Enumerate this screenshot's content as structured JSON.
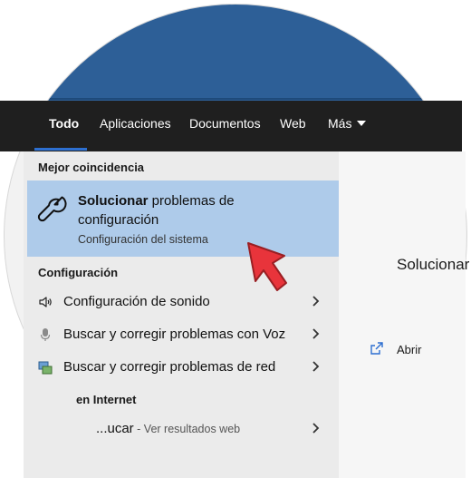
{
  "tabs": [
    {
      "label": "Todo",
      "active": true
    },
    {
      "label": "Aplicaciones"
    },
    {
      "label": "Documentos"
    },
    {
      "label": "Web"
    },
    {
      "label": "Más"
    }
  ],
  "best_match": {
    "section_title": "Mejor coincidencia",
    "title_bold": "Solucionar",
    "title_rest": " problemas de configuración",
    "subtitle": "Configuración del sistema",
    "icon": "wrench-icon"
  },
  "settings_section": {
    "title": "Configuración",
    "items": [
      {
        "label": "Configuración de sonido",
        "icon": "speaker-icon"
      },
      {
        "label": "Buscar y corregir problemas con Voz",
        "icon": "microphone-icon"
      },
      {
        "label": "Buscar y corregir problemas de red",
        "icon": "network-icon"
      }
    ]
  },
  "web_section": {
    "title": "en Internet",
    "item_label": "...ucar",
    "item_suffix": " - Ver resultados web"
  },
  "preview": {
    "title": "Solucionar",
    "open_label": "Abrir"
  },
  "colors": {
    "tab_bar": "#1f1f1f",
    "active_underline": "#2d6fd0",
    "highlight": "#aecbea",
    "desktop": "#2d5f97",
    "pointer": "#e8343b"
  }
}
